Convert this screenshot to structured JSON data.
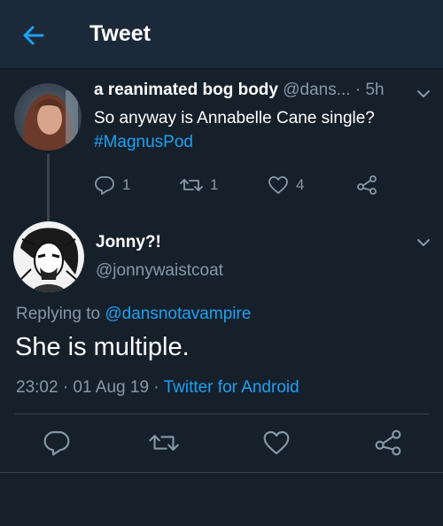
{
  "header": {
    "title": "Tweet",
    "back_icon": "arrow-left-icon",
    "accent": "#1da1f2",
    "background": "#1c2938"
  },
  "parent_tweet": {
    "display_name": "a reanimated bog body",
    "handle": "@dans...",
    "time": "· 5h",
    "text": "So anyway is Annabelle Cane single?",
    "hashtag": "#MagnusPod",
    "replies": "1",
    "retweets": "1",
    "likes": "4"
  },
  "main_tweet": {
    "display_name": "Jonny?!",
    "handle": "@jonnywaistcoat",
    "replying_prefix": "Replying to",
    "replying_to": "@dansnotavampire",
    "text": "She is multiple.",
    "time": "23:02 · 01 Aug 19 ·",
    "source": "Twitter for Android"
  },
  "colors": {
    "background": "#15202b",
    "muted": "#8899a6",
    "link": "#1da1f2",
    "divider": "#38444d"
  }
}
